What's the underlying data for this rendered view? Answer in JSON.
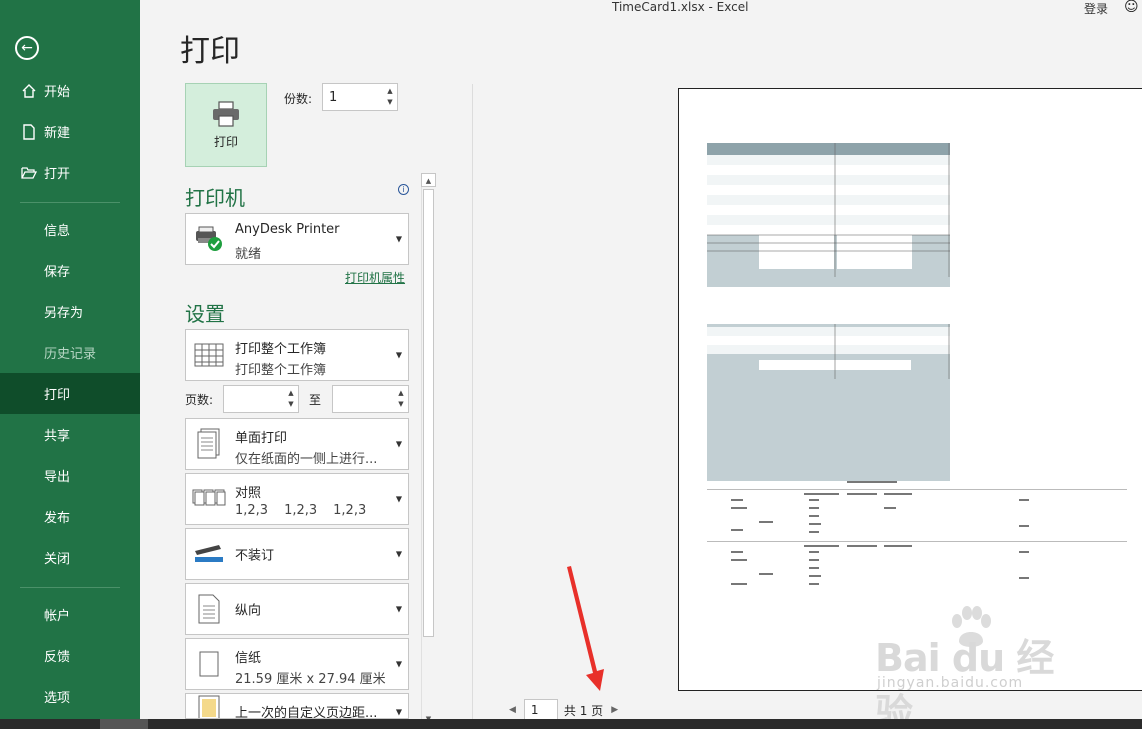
{
  "window": {
    "title": "TimeCard1.xlsx  -  Excel",
    "login": "登录"
  },
  "sidebar": {
    "items": [
      {
        "label": "开始",
        "icon": "home-icon"
      },
      {
        "label": "新建",
        "icon": "new-doc-icon"
      },
      {
        "label": "打开",
        "icon": "folder-open-icon"
      },
      {
        "label": "信息"
      },
      {
        "label": "保存"
      },
      {
        "label": "另存为"
      },
      {
        "label": "历史记录",
        "state": "disabled"
      },
      {
        "label": "打印",
        "state": "active"
      },
      {
        "label": "共享"
      },
      {
        "label": "导出"
      },
      {
        "label": "发布"
      },
      {
        "label": "关闭"
      },
      {
        "label": "帐户"
      },
      {
        "label": "反馈"
      },
      {
        "label": "选项"
      }
    ]
  },
  "print": {
    "heading": "打印",
    "button_label": "打印",
    "copies_label": "份数:",
    "copies_value": "1",
    "printer_section": "打印机",
    "printer_name": "AnyDesk Printer",
    "printer_status": "就绪",
    "printer_properties": "打印机属性",
    "settings_section": "设置",
    "scope": {
      "title": "打印整个工作簿",
      "subtitle": "打印整个工作簿"
    },
    "pages_label": "页数:",
    "pages_to": "至",
    "sides": {
      "title": "单面打印",
      "subtitle": "仅在纸面的一侧上进行..."
    },
    "collate": {
      "title": "对照",
      "values": [
        "1,2,3",
        "1,2,3",
        "1,2,3"
      ]
    },
    "staple": {
      "title": "不装订"
    },
    "orientation": {
      "title": "纵向"
    },
    "paper": {
      "title": "信纸",
      "subtitle": "21.59 厘米 x 27.94 厘米"
    },
    "margins": {
      "title": "上一次的自定义页边距..."
    }
  },
  "preview": {
    "page_current": "1",
    "page_total": "共 1 页"
  },
  "watermark": {
    "brand": "Bai du 经验",
    "url": "jingyan.baidu.com"
  },
  "colors": {
    "accent": "#217346",
    "active": "#0f4d2a",
    "arrow": "#e8302a"
  }
}
